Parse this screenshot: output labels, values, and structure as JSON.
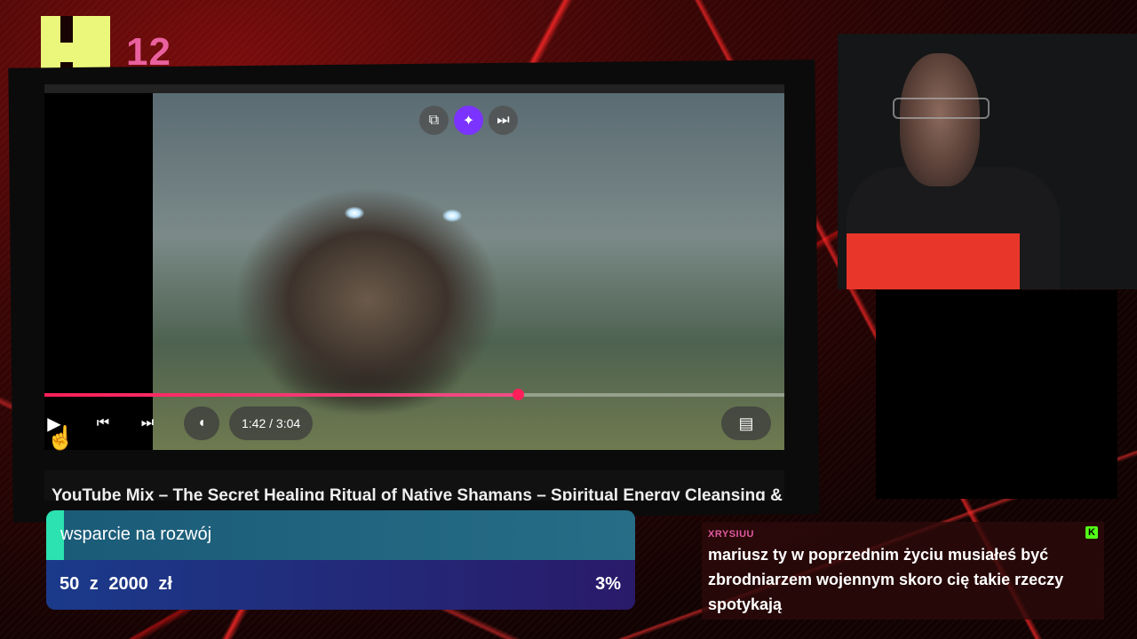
{
  "logo": {
    "number": "12"
  },
  "player": {
    "time": "1:42 / 3:04",
    "progress_fraction": 0.64,
    "title": "YouTube Mix – The Secret Healing Ritual of Native Shamans – Spiritual Energy Cleansing &",
    "icons": [
      "play-icon",
      "previous-icon",
      "next-icon",
      "volume-icon",
      "subtitles-icon",
      "miniplayer-icon",
      "sparkle-icon",
      "skip-icon"
    ]
  },
  "donation": {
    "title": "wsparcie na rozwój",
    "amount": "50 z 2000 zł",
    "percent": "3%",
    "progress_fraction": 0.03
  },
  "chat": {
    "username": "XRYSIUU",
    "badge": "K",
    "message": "mariusz ty w poprzednim życiu musiałeś być zbrodniarzem wojennym skoro cię takie rzeczy spotykają"
  },
  "colors": {
    "accent": "#ff1f5a",
    "logo": "#eaf77a",
    "logo_number": "#e9619e",
    "donation_fill": "#2be2b0",
    "chat_user": "#e05aa0",
    "kick_badge": "#53fc18"
  }
}
